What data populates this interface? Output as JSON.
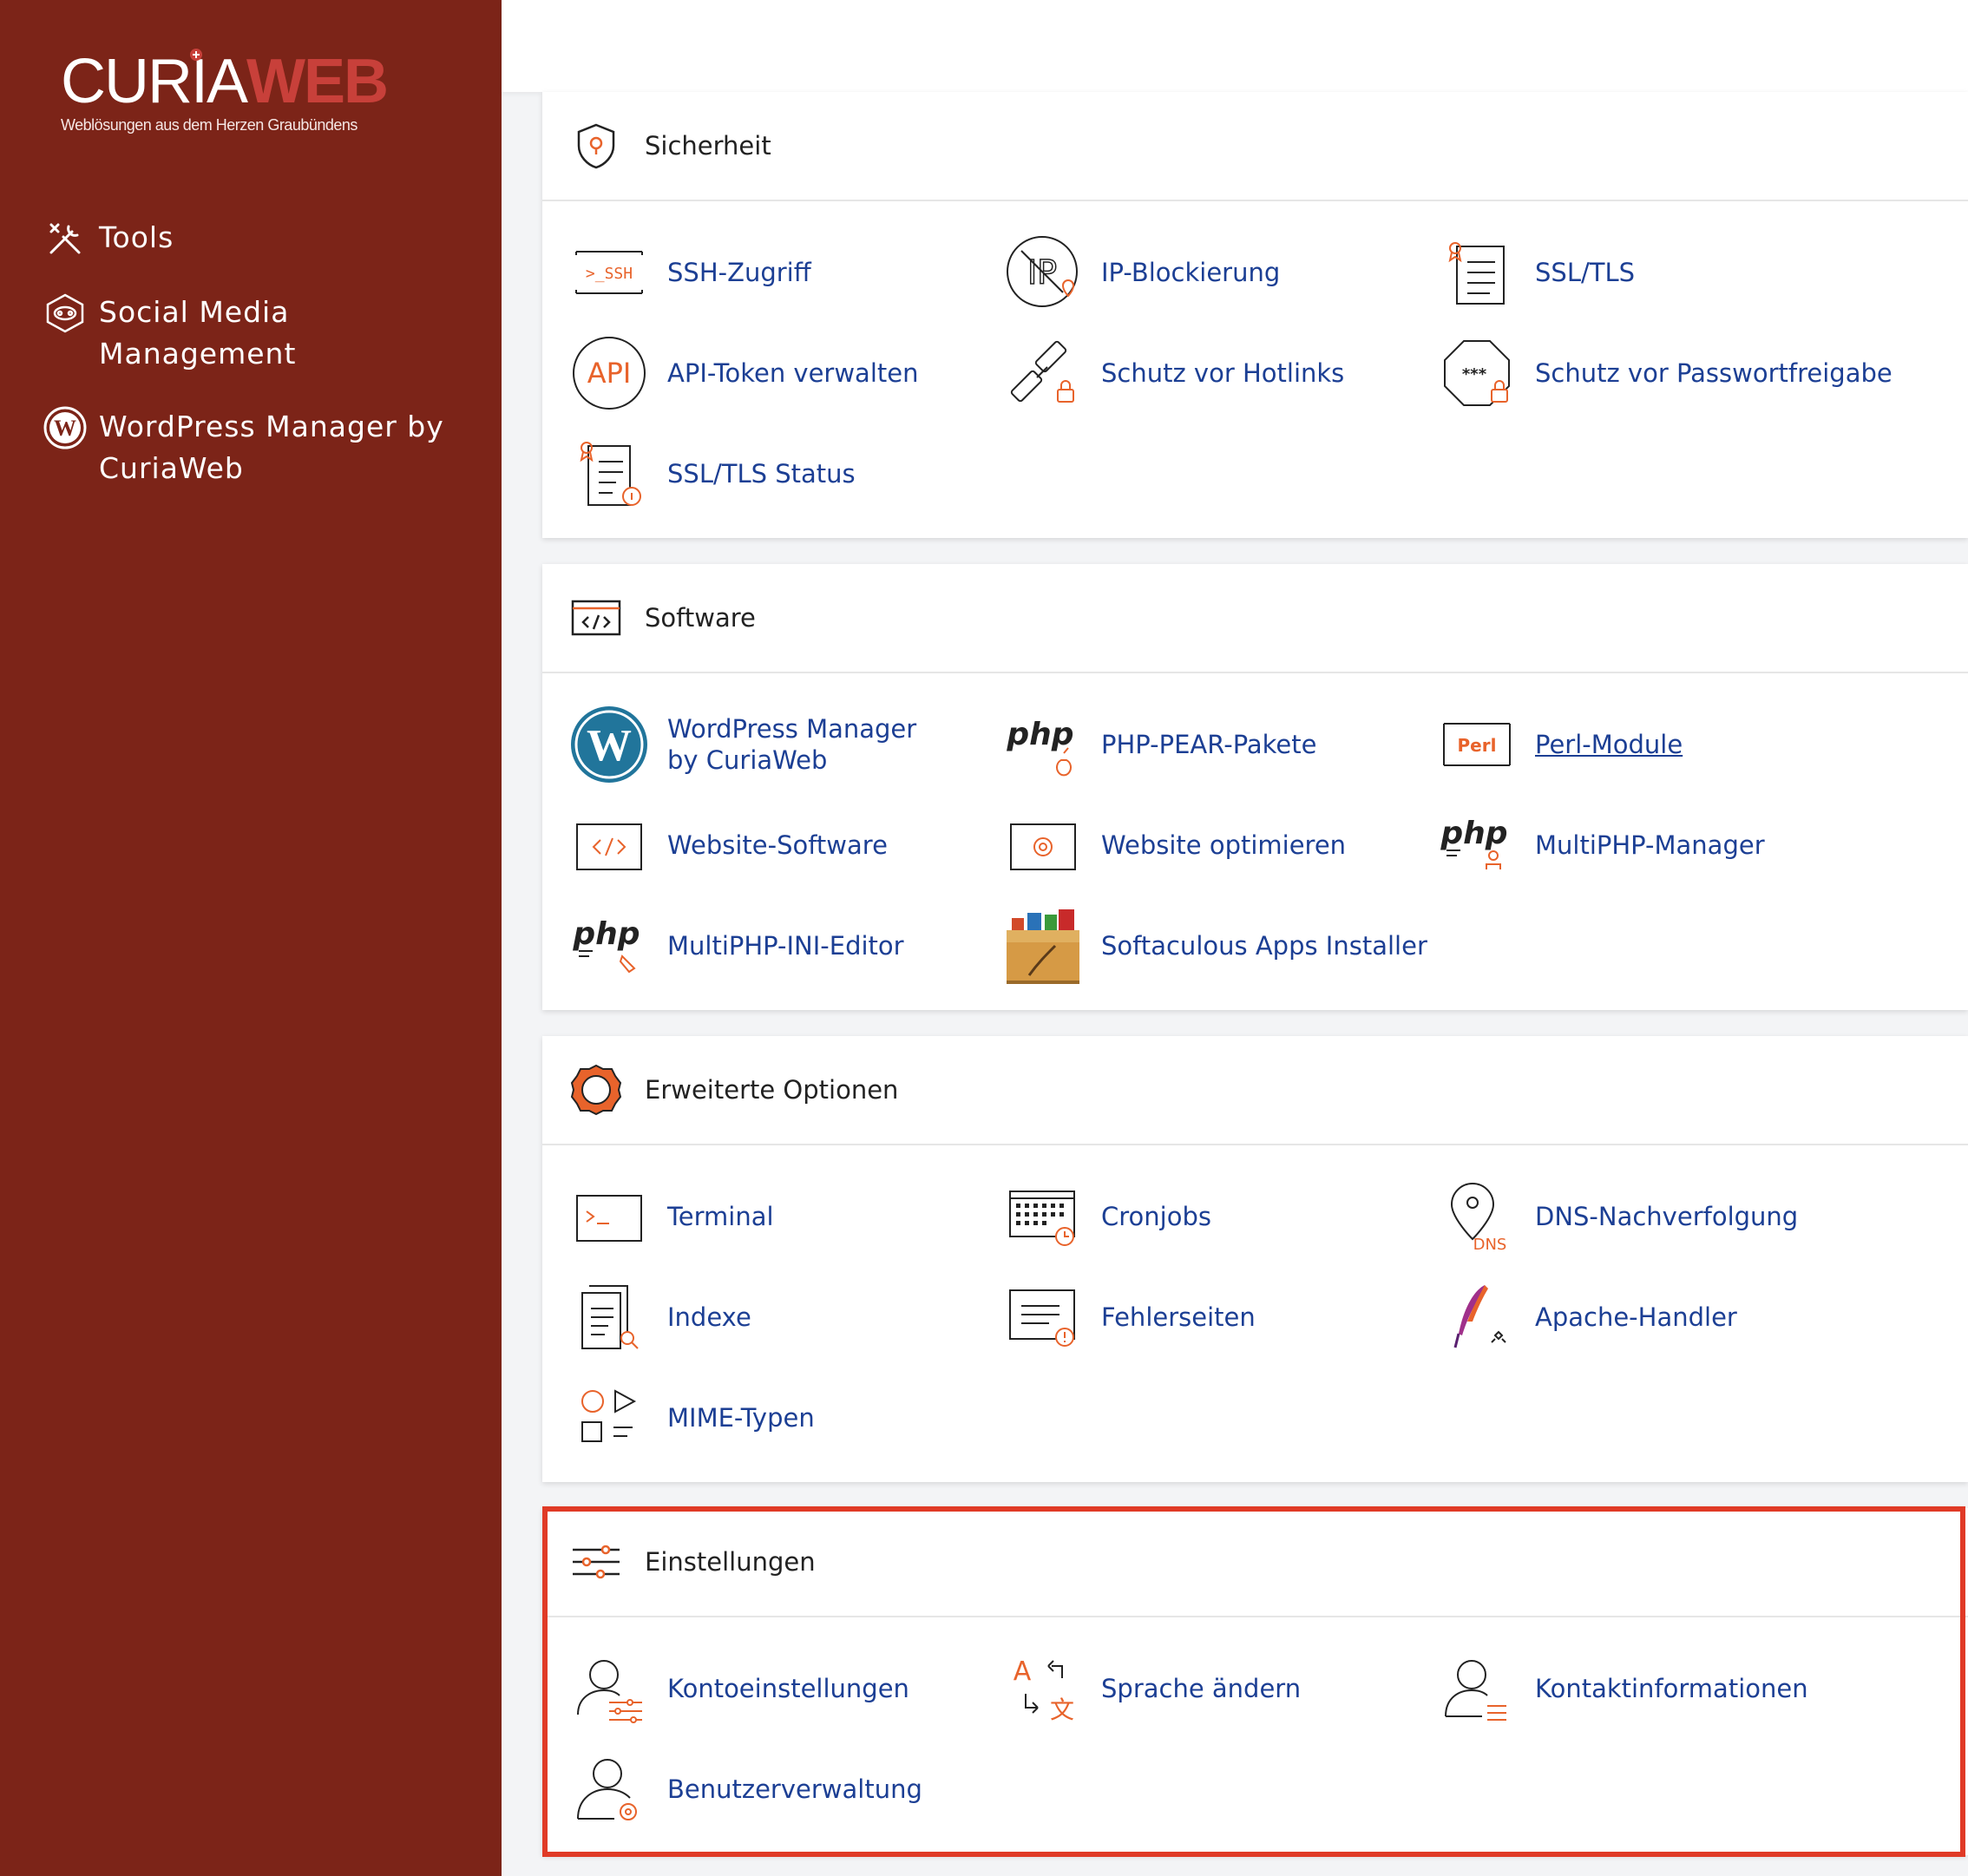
{
  "brand": {
    "name_part1": "CURIA",
    "name_part2": "WEB",
    "tagline": "Weblösungen aus dem Herzen Graubündens"
  },
  "sidebar": {
    "items": [
      {
        "label": "Tools",
        "icon": "tools-icon"
      },
      {
        "label": "Social Media Management",
        "icon": "social-media-icon"
      },
      {
        "label": "WordPress Manager by CuriaWeb",
        "icon": "wordpress-icon"
      }
    ]
  },
  "sections": {
    "sicherheit": {
      "title": "Sicherheit",
      "items": [
        "SSH-Zugriff",
        "IP-Blockierung",
        "SSL/TLS",
        "API-Token verwalten",
        "Schutz vor Hotlinks",
        "Schutz vor Passwortfreigabe",
        "SSL/TLS Status"
      ]
    },
    "software": {
      "title": "Software",
      "items": [
        "WordPress Manager by CuriaWeb",
        "PHP-PEAR-Pakete",
        "Perl-Module",
        "Website-Software",
        "Website optimieren",
        "MultiPHP-Manager",
        "MultiPHP-INI-Editor",
        "Softaculous Apps Installer"
      ]
    },
    "erweitert": {
      "title": "Erweiterte Optionen",
      "items": [
        "Terminal",
        "Cronjobs",
        "DNS-Nachverfolgung",
        "Indexe",
        "Fehlerseiten",
        "Apache-Handler",
        "MIME-Typen"
      ]
    },
    "einstellungen": {
      "title": "Einstellungen",
      "items": [
        "Kontoeinstellungen",
        "Sprache ändern",
        "Kontaktinformationen",
        "Benutzerverwaltung"
      ]
    }
  },
  "icon_text": {
    "ssh": ">_SSH",
    "ip": "IP",
    "api": "API",
    "php": "php",
    "perl": "Perl",
    "dns": "DNS",
    "pwd": "***",
    "lang_a": "A",
    "lang_b": "文"
  },
  "colors": {
    "sidebar_bg": "#7c2418",
    "accent": "#e8632b",
    "link": "#1c3f94",
    "highlight_border": "#e03a26"
  }
}
